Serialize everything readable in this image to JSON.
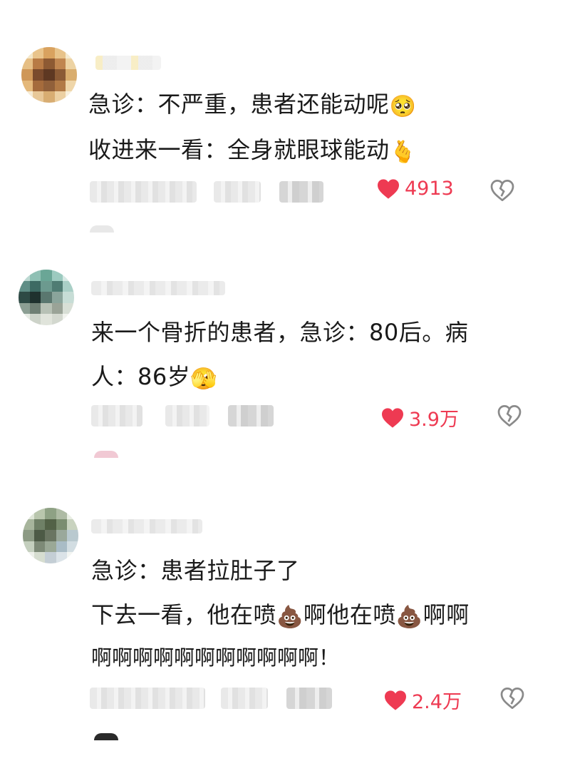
{
  "comments": [
    {
      "lines": [
        "急诊：不严重，患者还能动呢",
        "收进来一看：全身就眼球能动"
      ],
      "emojis": [
        "🥺",
        "🫰"
      ],
      "likes": "4913"
    },
    {
      "lines": [
        "来一个骨折的患者，急诊：80后。病",
        "人：86岁"
      ],
      "emojis": [
        "🫣"
      ],
      "likes": "3.9万"
    },
    {
      "lines": [
        "急诊：患者拉肚子了",
        "下去一看，他在喷",
        "啊他在喷",
        "啊啊",
        "啊啊啊啊啊啊啊啊啊啊啊！"
      ],
      "emojis": [
        "💩",
        "💩"
      ],
      "likes": "2.4万"
    }
  ],
  "icons": {
    "like": "heart-icon",
    "dislike": "broken-heart-icon"
  },
  "colors": {
    "like_red": "#ee3a52",
    "icon_gray": "#8a8a8a",
    "text": "#1a1a1a"
  }
}
